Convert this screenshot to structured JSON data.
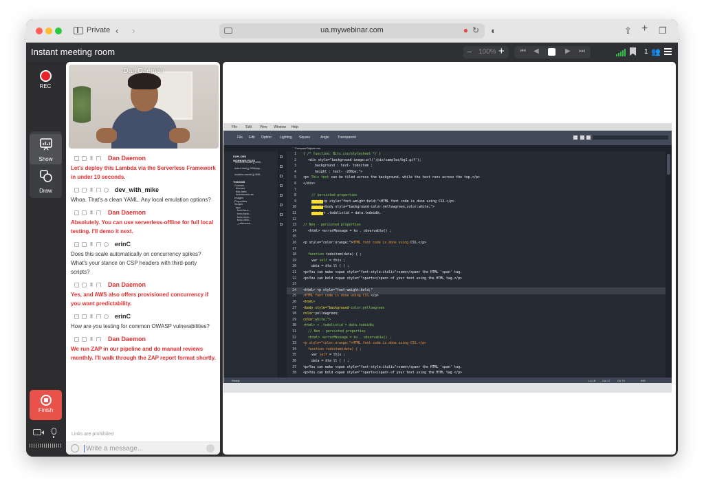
{
  "browser": {
    "private_label": "Private",
    "url": "ua.mywebinar.com"
  },
  "app": {
    "title": "Instant meeting room",
    "zoom": "100%",
    "participant_count": "1"
  },
  "rail": {
    "rec_label": "REC",
    "show_label": "Show",
    "draw_label": "Draw",
    "finish_label": "Finish"
  },
  "video": {
    "presenter_name": "Dan Daemon"
  },
  "chat": {
    "messages": [
      {
        "author": "Dan Daemon",
        "role": "host",
        "text": "Let's deploy this Lambda via the Serverless Framework in under 10 seconds."
      },
      {
        "author": "dev_with_mike",
        "role": "guest",
        "text": "Whoa. That's a clean YAML. Any local emulation options?"
      },
      {
        "author": "Dan Daemon",
        "role": "host",
        "text": "Absolutely. You can use serverless-offline for full local testing. I'll demo it next."
      },
      {
        "author": "erinC",
        "role": "guest",
        "text": "Does this scale automatically on concurrency spikes? What's your stance on CSP headers with third-party scripts?"
      },
      {
        "author": "Dan Daemon",
        "role": "host",
        "text": "Yes, and AWS also offers provisioned concurrency if you want predictability."
      },
      {
        "author": "erinC",
        "role": "guest",
        "text": "How are you testing for common OWASP vulnerabilities?"
      },
      {
        "author": "Dan Daemon",
        "role": "host",
        "text": "We run ZAP in our pipeline and do manual reviews monthly. I'll walk through the ZAP report format shortly."
      }
    ],
    "links_note": "Links are prohibited",
    "input_placeholder": "Write a message..."
  },
  "editor": {
    "menu": [
      "File",
      "Edit",
      "View",
      "Window",
      "Help"
    ],
    "toolbar": [
      "File",
      "Edit",
      "Option",
      "Lighting",
      "Square",
      "Angle",
      "Transparent"
    ],
    "tab": "CompareObjects.css",
    "explorer": [
      "EXPLORE",
      "WORKING FILES",
      "TodoDB.model.jj  /IDB...",
      "index.html.jj  /IDBApp...",
      "readme.model.jj  /IDB...",
      "TODODB",
      "Contact",
      "themes",
      "Bits.html",
      "todomodel.css",
      "Images",
      "Properties",
      "Scripts",
      "app",
      "todo.func...",
      "todo.back...",
      "todo.repo...",
      "todo.view...",
      "_reference..."
    ],
    "status": {
      "left": "Ready",
      "ln": "Ln 18",
      "col": "Col 17",
      "ch": "Ch 74",
      "mode": "INS"
    },
    "lines": [
      {
        "n": "1",
        "segs": [
          [
            "c-comment",
            "{ /* function: Bits.css/stylesheet */ }"
          ]
        ],
        "indent": "i0"
      },
      {
        "n": "2",
        "segs": [
          [
            "",
            "<div style=\"background-image:url('/pix/samples/bg1.gif');"
          ]
        ],
        "indent": "i1"
      },
      {
        "n": "3",
        "segs": [
          [
            "",
            "background : text- todoitem ;"
          ]
        ],
        "indent": "i3"
      },
      {
        "n": "4",
        "segs": [
          [
            "",
            "height : text- -200px;\">"
          ]
        ],
        "indent": "i3"
      },
      {
        "n": "5",
        "segs": [
          [
            "",
            "<p> "
          ],
          [
            "c-comment",
            "This text"
          ],
          [
            "",
            " can be tiled across the background, while the text runs across the top.</p>"
          ]
        ],
        "indent": "i0"
      },
      {
        "n": "6",
        "segs": [
          [
            "",
            "</div>"
          ]
        ],
        "indent": "i0"
      },
      {
        "n": "7",
        "segs": [],
        "indent": "i0"
      },
      {
        "n": "8",
        "segs": [
          [
            "c-comment",
            "//  persisted properties"
          ]
        ],
        "indent": "i2"
      },
      {
        "n": "9",
        "segs": [
          [
            "c-mark",
            "<html>"
          ],
          [
            "",
            "<p style=\"font-weight:bold;\">HTML font code is done using CSS.</p>"
          ]
        ],
        "indent": "i2"
      },
      {
        "n": "10",
        "segs": [
          [
            "c-mark",
            "<html>"
          ],
          [
            "",
            "<body style=\"background-color:yellowgreen;color:white;\">"
          ]
        ],
        "indent": "i2"
      },
      {
        "n": "11",
        "segs": [
          [
            "c-mark",
            "<html>"
          ],
          [
            "",
            "< .todolistid = data.todoidb;"
          ]
        ],
        "indent": "i2"
      },
      {
        "n": "12",
        "segs": [],
        "indent": "i0"
      },
      {
        "n": "13",
        "segs": [
          [
            "c-comment",
            "// Non - persisted properties"
          ]
        ],
        "indent": "i0"
      },
      {
        "n": "14",
        "segs": [
          [
            "",
            "<html> <errorMessage = ko . observable() ;"
          ]
        ],
        "indent": "i1"
      },
      {
        "n": "15",
        "segs": [],
        "indent": "i0"
      },
      {
        "n": "16",
        "segs": [
          [
            "",
            "<p style=\"color:orange;\">"
          ],
          [
            "c-orange",
            "HTML font code is done using"
          ],
          [
            "",
            " CSS.</p>"
          ]
        ],
        "indent": "i0"
      },
      {
        "n": "17",
        "segs": [],
        "indent": "i0"
      },
      {
        "n": "18",
        "segs": [
          [
            "c-comment",
            "function "
          ],
          [
            "",
            "todoitem(data) { ;"
          ]
        ],
        "indent": "i1"
      },
      {
        "n": "19",
        "segs": [
          [
            "",
            "var "
          ],
          [
            "c-comment",
            "self"
          ],
          [
            "",
            " = this ;"
          ]
        ],
        "indent": "i2"
      },
      {
        "n": "20",
        "segs": [
          [
            "",
            "data = dta  ll ( ) ;"
          ]
        ],
        "indent": "i2"
      },
      {
        "n": "21",
        "segs": [
          [
            "",
            "<p>You can make <span style=\"font-style:italic\">some</span> the HTML 'span' tag."
          ]
        ],
        "indent": "i0"
      },
      {
        "n": "22",
        "segs": [
          [
            "",
            "<p>You can bold <span style=\"\">parts</span> of your text using the HTML tag.</p>"
          ]
        ],
        "indent": "i0"
      },
      {
        "n": "23",
        "segs": [],
        "indent": "i0"
      },
      {
        "n": "24",
        "segs": [
          [
            "",
            "<html> <p style=\"font-weight:bold;\""
          ]
        ],
        "indent": "i0",
        "hl": true
      },
      {
        "n": "25",
        "segs": [
          [
            "c-orange",
            ">HTML font code is done using CSS."
          ],
          [
            "",
            "</p>"
          ]
        ],
        "indent": "i0"
      },
      {
        "n": "26",
        "segs": [
          [
            "c-yellow",
            "<html>"
          ]
        ],
        "indent": "i0"
      },
      {
        "n": "27",
        "segs": [
          [
            "c-yellow",
            "<body style=\"background"
          ],
          [
            "c-comment",
            "-color:yellowgreen"
          ]
        ],
        "indent": "i0"
      },
      {
        "n": "28",
        "segs": [
          [
            "c-yellow",
            "color:"
          ],
          [
            "",
            "yellowgreen;"
          ]
        ],
        "indent": "i0"
      },
      {
        "n": "29",
        "segs": [
          [
            "c-yellow",
            "color:"
          ],
          [
            "c-comment",
            "white;\">"
          ]
        ],
        "indent": "i0"
      },
      {
        "n": "30",
        "segs": [
          [
            "c-comment",
            "<html> < .todolistid = data.todoidb;"
          ]
        ],
        "indent": "i0"
      },
      {
        "n": "31",
        "segs": [
          [
            "c-comment",
            "// Non - persisted properties"
          ]
        ],
        "indent": "i1"
      },
      {
        "n": "32",
        "segs": [
          [
            "c-comment",
            "<html> <errorMessage = ko . observable() ;"
          ]
        ],
        "indent": "i1"
      },
      {
        "n": "33",
        "segs": [
          [
            "c-orange",
            "<p style=\"color:orange;\">HTML font code is done using CSS.</p>"
          ]
        ],
        "indent": "i0"
      },
      {
        "n": "34",
        "segs": [
          [
            "c-orange",
            "function todoitem(data) { ;"
          ]
        ],
        "indent": "i1"
      },
      {
        "n": "35",
        "segs": [
          [
            "",
            "var "
          ],
          [
            "c-orange",
            "self"
          ],
          [
            "",
            " = this ;"
          ]
        ],
        "indent": "i2"
      },
      {
        "n": "36",
        "segs": [
          [
            "",
            "data = dta  ll ( ) ;"
          ]
        ],
        "indent": "i2"
      },
      {
        "n": "37",
        "segs": [
          [
            "",
            "<p>You can make <span style=\"font-style:italic\">some</span> the HTML 'span' tag."
          ]
        ],
        "indent": "i0"
      },
      {
        "n": "38",
        "segs": [
          [
            "",
            "<p>You can bold <span style=\"\">parts</span> of your text using the HTML tag </p>"
          ]
        ],
        "indent": "i0"
      }
    ]
  }
}
